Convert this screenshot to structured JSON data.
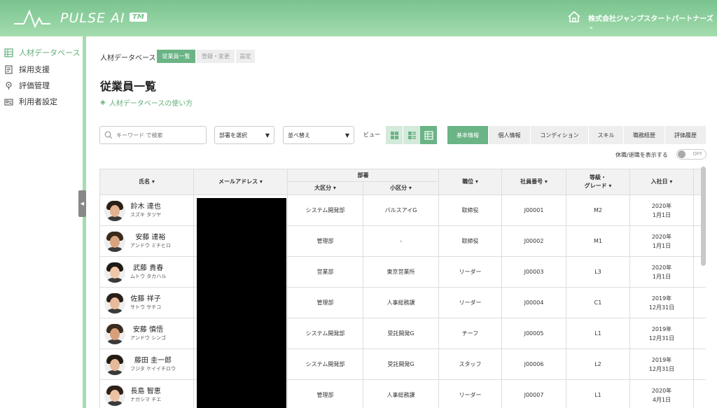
{
  "header": {
    "logo_text": "PULSE AI",
    "logo_tm": "TM",
    "company": "株式会社ジャンプスタートパートナーズ ⌄"
  },
  "sidebar": {
    "items": [
      {
        "label": "人材データベース",
        "icon": "database-icon",
        "active": true
      },
      {
        "label": "採用支援",
        "icon": "document-icon",
        "active": false
      },
      {
        "label": "評価管理",
        "icon": "pin-icon",
        "active": false
      },
      {
        "label": "利用者設定",
        "icon": "user-card-icon",
        "active": false
      }
    ]
  },
  "breadcrumb": {
    "title": "人材データベース",
    "tabs": [
      "従業員一覧",
      "登録・変更",
      "設定"
    ]
  },
  "page": {
    "title": "従業員一覧",
    "help_link": "人材データベースの使い方"
  },
  "filters": {
    "search_placeholder": "キーワード で検索",
    "department_select": "部署を選択",
    "sort_select": "並べ替え",
    "view_label": "ビュー"
  },
  "category_tabs": [
    "基本情報",
    "個人情報",
    "コンディション",
    "スキル",
    "職務経歴",
    "評価履歴"
  ],
  "toggle": {
    "label": "休職/退職を表示する",
    "state": "OFF"
  },
  "table": {
    "headers": {
      "name": "氏名 ▾",
      "email": "メールアドレス ▾",
      "department": "部署",
      "major": "大区分 ▾",
      "minor": "小区分 ▾",
      "position": "職位 ▾",
      "employee_no": "社員番号 ▾",
      "grade_line1": "等級・",
      "grade_line2": "グレード ▾",
      "joined": "入社日 ▾"
    },
    "rows": [
      {
        "name": "鈴木 達也",
        "kana": "スズキ タツヤ",
        "major": "システム開発部",
        "minor": "パルスアイG",
        "position": "取締役",
        "no": "J00001",
        "grade": "M2",
        "joined_y": "2020年",
        "joined_d": "1月1日"
      },
      {
        "name": "安藤 達裕",
        "kana": "アンドウ ミチヒロ",
        "major": "管理部",
        "minor": "-",
        "position": "取締役",
        "no": "J00002",
        "grade": "M1",
        "joined_y": "2020年",
        "joined_d": "1月1日"
      },
      {
        "name": "武藤 貴春",
        "kana": "ムトウ タカハル",
        "major": "営業部",
        "minor": "東京営業所",
        "position": "リーダー",
        "no": "J00003",
        "grade": "L3",
        "joined_y": "2020年",
        "joined_d": "1月1日"
      },
      {
        "name": "佐藤 祥子",
        "kana": "サトウ サチコ",
        "major": "管理部",
        "minor": "人事総務課",
        "position": "リーダー",
        "no": "J00004",
        "grade": "C1",
        "joined_y": "2019年",
        "joined_d": "12月31日"
      },
      {
        "name": "安藤 慎悟",
        "kana": "アンドウ シンゴ",
        "major": "システム開発部",
        "minor": "受託開発G",
        "position": "チーフ",
        "no": "J00005",
        "grade": "L1",
        "joined_y": "2019年",
        "joined_d": "12月31日"
      },
      {
        "name": "藤田 圭一郎",
        "kana": "フジタ ケイイチロウ",
        "major": "システム開発部",
        "minor": "受託開発G",
        "position": "スタッフ",
        "no": "J00006",
        "grade": "L2",
        "joined_y": "2019年",
        "joined_d": "12月31日"
      },
      {
        "name": "長島 智恵",
        "kana": "ナガシマ チエ",
        "major": "管理部",
        "minor": "人事総務課",
        "position": "リーダー",
        "no": "J00007",
        "grade": "L1",
        "joined_y": "2020年",
        "joined_d": "4月1日"
      }
    ]
  },
  "colors": {
    "accent": "#6ab485",
    "header_top": "#79c38f",
    "header_bottom": "#a4dcae"
  }
}
